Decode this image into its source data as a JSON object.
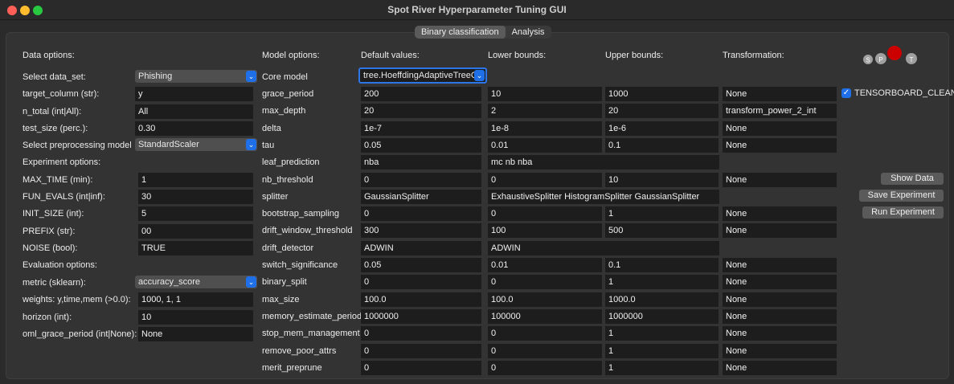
{
  "window": {
    "title": "Spot River Hyperparameter Tuning GUI"
  },
  "tabs": [
    {
      "label": "Binary classification",
      "active": true
    },
    {
      "label": "Analysis",
      "active": false
    }
  ],
  "left": {
    "data_options": "Data options:",
    "experiment_options": "Experiment options:",
    "evaluation_options": "Evaluation options:",
    "select_data_set": {
      "label": "Select data_set:",
      "value": "Phishing"
    },
    "target_column": {
      "label": "target_column (str):",
      "value": "y"
    },
    "n_total": {
      "label": "n_total (int|All):",
      "value": "All"
    },
    "test_size": {
      "label": "test_size (perc.):",
      "value": "0.30"
    },
    "preprocessing": {
      "label": "Select preprocessing model",
      "value": "StandardScaler"
    },
    "max_time": {
      "label": "MAX_TIME (min):",
      "value": "1"
    },
    "fun_evals": {
      "label": "FUN_EVALS (int|inf):",
      "value": "30"
    },
    "init_size": {
      "label": "INIT_SIZE (int):",
      "value": "5"
    },
    "prefix": {
      "label": "PREFIX (str):",
      "value": "00"
    },
    "noise": {
      "label": "NOISE (bool):",
      "value": "TRUE"
    },
    "metric": {
      "label": "metric (sklearn):",
      "value": "accuracy_score"
    },
    "weights": {
      "label": "weights: y,time,mem (>0.0):",
      "value": "1000, 1, 1"
    },
    "horizon": {
      "label": "horizon (int):",
      "value": "10"
    },
    "oml_grace": {
      "label": "oml_grace_period (int|None):",
      "value": "None"
    }
  },
  "model": {
    "header": "Model options:",
    "col_default": "Default values:",
    "col_lower": "Lower bounds:",
    "col_upper": "Upper bounds:",
    "col_transform": "Transformation:",
    "core_model_label": "Core model",
    "core_model_value": "tree.HoeffdingAdaptiveTreeC",
    "rows": [
      {
        "name": "grace_period",
        "default": "200",
        "lower": "10",
        "upper": "1000",
        "transform": "None"
      },
      {
        "name": "max_depth",
        "default": "20",
        "lower": "2",
        "upper": "20",
        "transform": "transform_power_2_int"
      },
      {
        "name": "delta",
        "default": "1e-7",
        "lower": "1e-8",
        "upper": "1e-6",
        "transform": "None"
      },
      {
        "name": "tau",
        "default": "0.05",
        "lower": "0.01",
        "upper": "0.1",
        "transform": "None"
      },
      {
        "name": "leaf_prediction",
        "default": "nba",
        "lower": "mc nb nba"
      },
      {
        "name": "nb_threshold",
        "default": "0",
        "lower": "0",
        "upper": "10",
        "transform": "None"
      },
      {
        "name": "splitter",
        "default": "GaussianSplitter",
        "lower": "ExhaustiveSplitter HistogramSplitter GaussianSplitter"
      },
      {
        "name": "bootstrap_sampling",
        "default": "0",
        "lower": "0",
        "upper": "1",
        "transform": "None"
      },
      {
        "name": "drift_window_threshold",
        "default": "300",
        "lower": "100",
        "upper": "500",
        "transform": "None"
      },
      {
        "name": "drift_detector",
        "default": "ADWIN",
        "lower": "ADWIN"
      },
      {
        "name": "switch_significance",
        "default": "0.05",
        "lower": "0.01",
        "upper": "0.1",
        "transform": "None"
      },
      {
        "name": "binary_split",
        "default": "0",
        "lower": "0",
        "upper": "1",
        "transform": "None"
      },
      {
        "name": "max_size",
        "default": "100.0",
        "lower": "100.0",
        "upper": "1000.0",
        "transform": "None"
      },
      {
        "name": "memory_estimate_period",
        "default": "1000000",
        "lower": "100000",
        "upper": "1000000",
        "transform": "None"
      },
      {
        "name": "stop_mem_management",
        "default": "0",
        "lower": "0",
        "upper": "1",
        "transform": "None"
      },
      {
        "name": "remove_poor_attrs",
        "default": "0",
        "lower": "0",
        "upper": "1",
        "transform": "None"
      },
      {
        "name": "merit_preprune",
        "default": "0",
        "lower": "0",
        "upper": "1",
        "transform": "None"
      }
    ]
  },
  "tensorboard": {
    "label": "TENSORBOARD_CLEAN",
    "checked": true
  },
  "buttons": {
    "show_data": "Show Data",
    "save_experiment": "Save Experiment",
    "run_experiment": "Run Experiment"
  },
  "logo": {
    "letters": [
      "S",
      "P",
      "O",
      "T"
    ],
    "accent": "#cc0000"
  },
  "colors": {
    "accent": "#1e6fe8",
    "field_bg": "#1d1d1d",
    "panel_bg": "#333333"
  }
}
